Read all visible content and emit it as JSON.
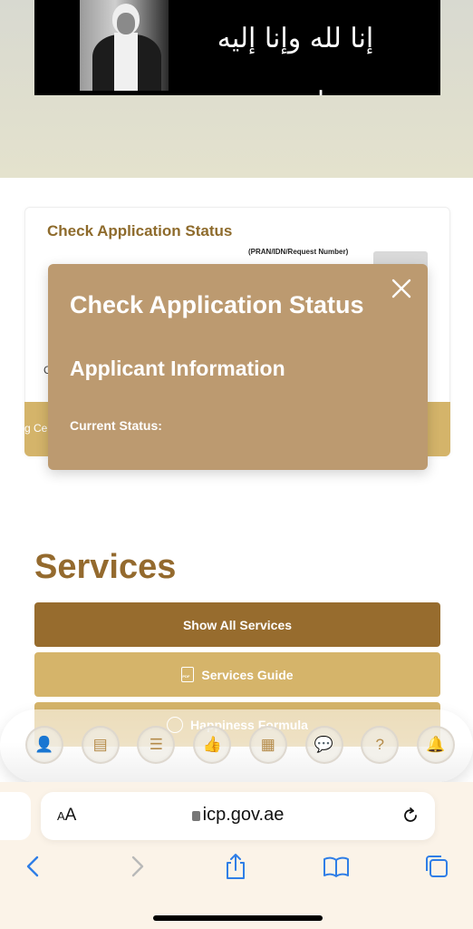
{
  "banner": {
    "calligraphy_text": "إنا لله وإنا إليه راجعون"
  },
  "status_card": {
    "title": "Check Application Status",
    "input_hint": "(PRAN/IDN/Request Number)",
    "input_value": "",
    "obscured_label_fragment": "C",
    "band_text_fragment": "g Ce"
  },
  "modal": {
    "title": "Check Application Status",
    "subtitle": "Applicant Information",
    "current_status_label": "Current Status:",
    "close_icon": "close-icon"
  },
  "services": {
    "title": "Services",
    "buttons": [
      {
        "label": "Show All Services",
        "color": "#976c2e"
      },
      {
        "label": "Services Guide",
        "icon": "pdf-icon",
        "color": "#d5b46a"
      },
      {
        "label": "Happiness Formula",
        "icon": "smile-icon",
        "color": "#d5b46a"
      }
    ]
  },
  "dock": {
    "icons": [
      {
        "name": "assistant-avatar-icon",
        "glyph": "👤"
      },
      {
        "name": "web-form-icon",
        "glyph": "▤"
      },
      {
        "name": "checklist-icon",
        "glyph": "☰"
      },
      {
        "name": "rating-thumbs-up-icon",
        "glyph": "👍"
      },
      {
        "name": "social-media-icon",
        "glyph": "▦"
      },
      {
        "name": "feedback-chat-icon",
        "glyph": "💬"
      },
      {
        "name": "help-question-icon",
        "glyph": "?"
      },
      {
        "name": "notification-bell-icon",
        "glyph": "🔔"
      }
    ]
  },
  "browser": {
    "aa_label_small": "A",
    "aa_label_large": "A",
    "url": "icp.gov.ae"
  },
  "colors": {
    "brand_dark": "#976c2e",
    "brand_light": "#d5b46a",
    "modal_bg": "#bc9a70",
    "ios_blue": "#2f7ee6"
  }
}
